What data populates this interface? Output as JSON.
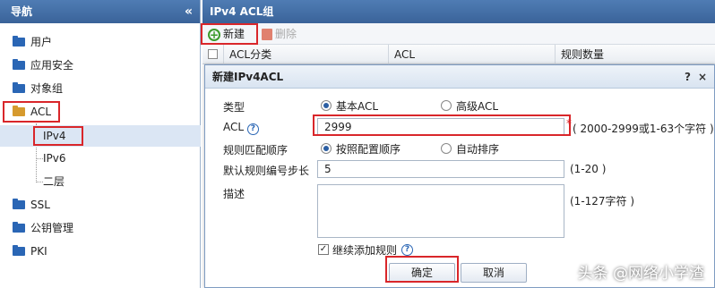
{
  "sidebar": {
    "title": "导航",
    "collapse_icon": "«",
    "items": [
      {
        "label": "用户",
        "icon": "folder-icon"
      },
      {
        "label": "应用安全",
        "icon": "folder-icon"
      },
      {
        "label": "对象组",
        "icon": "folder-icon"
      },
      {
        "label": "ACL",
        "icon": "folder-open-icon"
      },
      {
        "label": "SSL",
        "icon": "folder-icon"
      },
      {
        "label": "公钥管理",
        "icon": "folder-icon"
      },
      {
        "label": "PKI",
        "icon": "folder-icon"
      }
    ],
    "acl_children": [
      {
        "label": "IPv4"
      },
      {
        "label": "IPv6"
      },
      {
        "label": "二层"
      }
    ]
  },
  "main": {
    "title": "IPv4 ACL组",
    "toolbar": {
      "new_label": "新建",
      "delete_label": "删除"
    },
    "grid_columns": [
      "ACL分类",
      "ACL",
      "规则数量"
    ]
  },
  "dialog": {
    "title": "新建IPv4ACL",
    "help_icon": "?",
    "close_icon": "×",
    "type_label": "类型",
    "type_options": [
      "基本ACL",
      "高级ACL"
    ],
    "type_selected": "基本ACL",
    "acl_label": "ACL",
    "acl_value": "2999",
    "acl_required_mark": "*",
    "acl_hint": "( 2000-2999或1-63个字符 )",
    "order_label": "规则匹配顺序",
    "order_options": [
      "按照配置顺序",
      "自动排序"
    ],
    "order_selected": "按照配置顺序",
    "step_label": "默认规则编号步长",
    "step_value": "5",
    "step_hint": "(1-20 )",
    "desc_label": "描述",
    "desc_value": "",
    "desc_hint": "(1-127字符 )",
    "continue_label": "继续添加规则",
    "continue_checked": true,
    "ok_label": "确定",
    "cancel_label": "取消"
  },
  "watermark": "头条 @网络小学渣",
  "colors": {
    "header_blue": "#3a6399",
    "highlight_red": "#d9262a",
    "selected_bg": "#dbe6f4"
  }
}
